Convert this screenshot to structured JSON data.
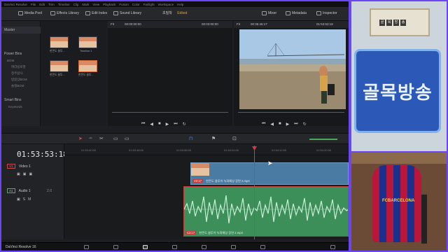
{
  "menubar": {
    "items": [
      "DaVinci Resolve",
      "File",
      "Edit",
      "Trim",
      "Timeline",
      "Clip",
      "Mark",
      "View",
      "Playback",
      "Fusion",
      "Color",
      "Fairlight",
      "Workspace",
      "Help"
    ]
  },
  "toolbar": {
    "media_pool": "Media Pool",
    "effects_library": "Effects Library",
    "edit_index": "Edit Index",
    "sound_library": "Sound Library",
    "project_name": "초밀착",
    "edited": "Edited",
    "mixer": "Mixer",
    "metadata": "Metadata",
    "inspector": "Inspector"
  },
  "left_panel": {
    "master": "Master",
    "power_bins": "Power Bins",
    "bins": [
      "BGM",
      "여리밤로열",
      "청주밤사",
      "밤봄상BGM",
      "슬렝BGM"
    ],
    "smart_bins": "Smart Bins",
    "keywords": "Keywords"
  },
  "media_pool": {
    "clips": [
      {
        "label": "한몬도 꿀투..."
      },
      {
        "label": "Timeline 1"
      },
      {
        "label": "한몬도 꿀투..."
      },
      {
        "label": "한몬도 꿀투..."
      }
    ]
  },
  "source_viewer": {
    "zoom": "Fit",
    "timecode_left": "00:00:00:00",
    "timecode_right": "00:03:00:00"
  },
  "timeline_viewer": {
    "zoom": "Fit",
    "timecode_left": "00:35:46:17",
    "timecode_right": "01:53:53:18"
  },
  "timeline": {
    "current_timecode": "01:53:53:18",
    "ruler_ticks": [
      "01:53:40:00",
      "01:53:48:00",
      "01:53:56:00",
      "01:54:04:00",
      "01:54:12:00",
      "01:54:20:00"
    ],
    "tracks": [
      {
        "badge": "V1",
        "name": "Video 1"
      },
      {
        "badge": "A1",
        "name": "Audio 1",
        "level": "2.0"
      }
    ],
    "video_clip": {
      "tag": "V2:17",
      "name": "한몬도 꿀투어 녹화예상 장면 2.mp4"
    },
    "audio_clip": {
      "tag": "C2:17",
      "name": "한몬도 꿀투어 녹화예상 장면 2.mp4"
    }
  },
  "bottombar": {
    "app_label": "DaVinci Resolve 16"
  },
  "side_panel": {
    "banner_text": "골목방송",
    "plaque_tiles": [
      "골",
      "목",
      "방",
      "송"
    ],
    "chair_text": "FCBARCELONA"
  },
  "colors": {
    "frame": "#6a46f5",
    "video_clip": "#4a7ba3",
    "audio_clip": "#3d8f5a",
    "playhead": "#d63a3a",
    "accent_orange": "#e0a33a"
  }
}
